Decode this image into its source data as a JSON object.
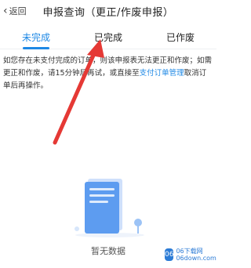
{
  "header": {
    "back_label": "返回",
    "title": "申报查询（更正/作废申报）"
  },
  "tabs": [
    {
      "label": "未完成",
      "active": true
    },
    {
      "label": "已完成",
      "active": false
    },
    {
      "label": "已作废",
      "active": false
    }
  ],
  "notice": {
    "text_before": "如您存在未支付完成的订单，则该申报表无法更正和作废；如需更正和作废，请15分钟后再试，或直接至",
    "link_text": "支付订单管理",
    "text_after": "取消订单后再操作。"
  },
  "empty_state": {
    "text": "暂无数据"
  },
  "watermark": {
    "logo_text": "06",
    "line1": "06下载网",
    "line2": "06down.com"
  },
  "colors": {
    "accent": "#1e88e5",
    "arrow": "#e53935"
  }
}
